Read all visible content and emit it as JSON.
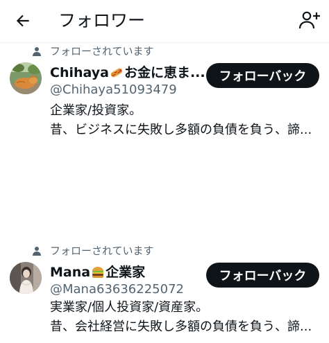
{
  "header": {
    "title": "フォロワー",
    "back_icon": "arrow-left-icon",
    "add_icon": "add-user-icon"
  },
  "followers": [
    {
      "follows_you_label": "フォローされています",
      "name_prefix": "Chihaya",
      "name_emoji": "hotdog-emoji",
      "name_suffix": "お金に恵ま...",
      "handle": "@Chihaya51093479",
      "bio_line1": "企業家/投資家。",
      "bio_line2": "昔、ビジネスに失敗し多額の負債を負う、諦...",
      "button_label": "フォローバック"
    },
    {
      "follows_you_label": "フォローされています",
      "name_prefix": "Mana",
      "name_emoji": "burger-emoji",
      "name_suffix": "企業家",
      "handle": "@Mana63636225072",
      "bio_line1": "実業家/個人投資家/資産家。",
      "bio_line2": "昔、会社経営に失敗し多額の負債を負う、諦...",
      "button_label": "フォローバック"
    }
  ],
  "colors": {
    "text": "#0f1419",
    "secondary": "#536471",
    "button_bg": "#0f1419",
    "button_text": "#ffffff"
  }
}
